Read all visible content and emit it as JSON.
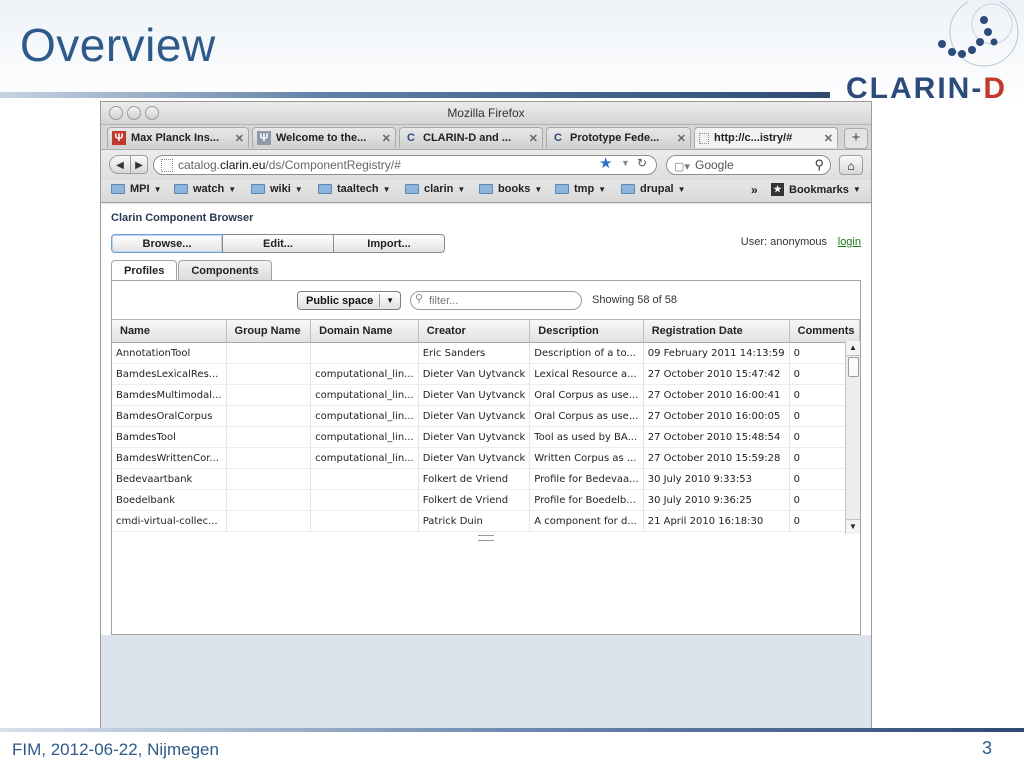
{
  "slide": {
    "title": "Overview",
    "logo_main": "CLARIN-",
    "logo_accent": "D",
    "footer_left": "FIM, 2012-06-22, Nijmegen",
    "page_number": "3"
  },
  "browser": {
    "window_title": "Mozilla Firefox",
    "tabs": [
      {
        "label": "Max Planck Ins...",
        "icon": "mpi-favicon",
        "close": "✕"
      },
      {
        "label": "Welcome to the...",
        "icon": "mpi-favicon",
        "close": "✕"
      },
      {
        "label": "CLARIN-D and ...",
        "icon": "clarin-favicon",
        "close": "✕"
      },
      {
        "label": "Prototype Fede...",
        "icon": "clarin-favicon",
        "close": "✕"
      },
      {
        "label": "http://c...istry/#",
        "icon": "blank-page-icon",
        "close": "✕"
      }
    ],
    "new_tab": "+",
    "url_prefix": "catalog.",
    "url_host": "clarin.eu",
    "url_path": "/ds/ComponentRegistry/#",
    "search_placeholder": "Google",
    "bookmarks": [
      {
        "label": "MPI"
      },
      {
        "label": "watch"
      },
      {
        "label": "wiki"
      },
      {
        "label": "taaltech"
      },
      {
        "label": "clarin"
      },
      {
        "label": "books"
      },
      {
        "label": "tmp"
      },
      {
        "label": "drupal"
      }
    ],
    "bookmarks_overflow": "»",
    "bookmarks_menu": "Bookmarks"
  },
  "app": {
    "title": "Clarin Component Browser",
    "buttons": {
      "browse": "Browse...",
      "edit": "Edit...",
      "import": "Import..."
    },
    "user_label": "User: anonymous",
    "login": "login",
    "tabs": {
      "profiles": "Profiles",
      "components": "Components"
    },
    "space_select": "Public space",
    "filter_placeholder": "filter...",
    "showing": "Showing 58 of 58",
    "columns": [
      "Name",
      "Group Name",
      "Domain Name",
      "Creator",
      "Description",
      "Registration Date",
      "Comments"
    ],
    "rows": [
      [
        "AnnotationTool",
        "",
        "",
        "Eric Sanders",
        "Description of a to...",
        "09 February 2011 14:13:59",
        "0"
      ],
      [
        "BamdesLexicalRes...",
        "",
        "computational_lin...",
        "Dieter Van Uytvanck",
        "Lexical Resource a...",
        "27 October 2010 15:47:42",
        "0"
      ],
      [
        "BamdesMultimodal...",
        "",
        "computational_lin...",
        "Dieter Van Uytvanck",
        "Oral Corpus as use...",
        "27 October 2010 16:00:41",
        "0"
      ],
      [
        "BamdesOralCorpus",
        "",
        "computational_lin...",
        "Dieter Van Uytvanck",
        "Oral Corpus as use...",
        "27 October 2010 16:00:05",
        "0"
      ],
      [
        "BamdesTool",
        "",
        "computational_lin...",
        "Dieter Van Uytvanck",
        "Tool as used by BA...",
        "27 October 2010 15:48:54",
        "0"
      ],
      [
        "BamdesWrittenCor...",
        "",
        "computational_lin...",
        "Dieter Van Uytvanck",
        "Written Corpus as ...",
        "27 October 2010 15:59:28",
        "0"
      ],
      [
        "Bedevaartbank",
        "",
        "",
        "Folkert de Vriend",
        "Profile for Bedevaa...",
        "30 July 2010 9:33:53",
        "0"
      ],
      [
        "Boedelbank",
        "",
        "",
        "Folkert de Vriend",
        "Profile for Boedelb...",
        "30 July 2010 9:36:25",
        "0"
      ],
      [
        "cmdi-virtual-collec...",
        "",
        "",
        "Patrick Duin",
        "A component for d...",
        "21 April 2010 16:18:30",
        "0"
      ]
    ]
  },
  "colors": {
    "title_blue": "#2e5a8a",
    "logo_red": "#c0392b",
    "link_green": "#1a7a1a"
  }
}
